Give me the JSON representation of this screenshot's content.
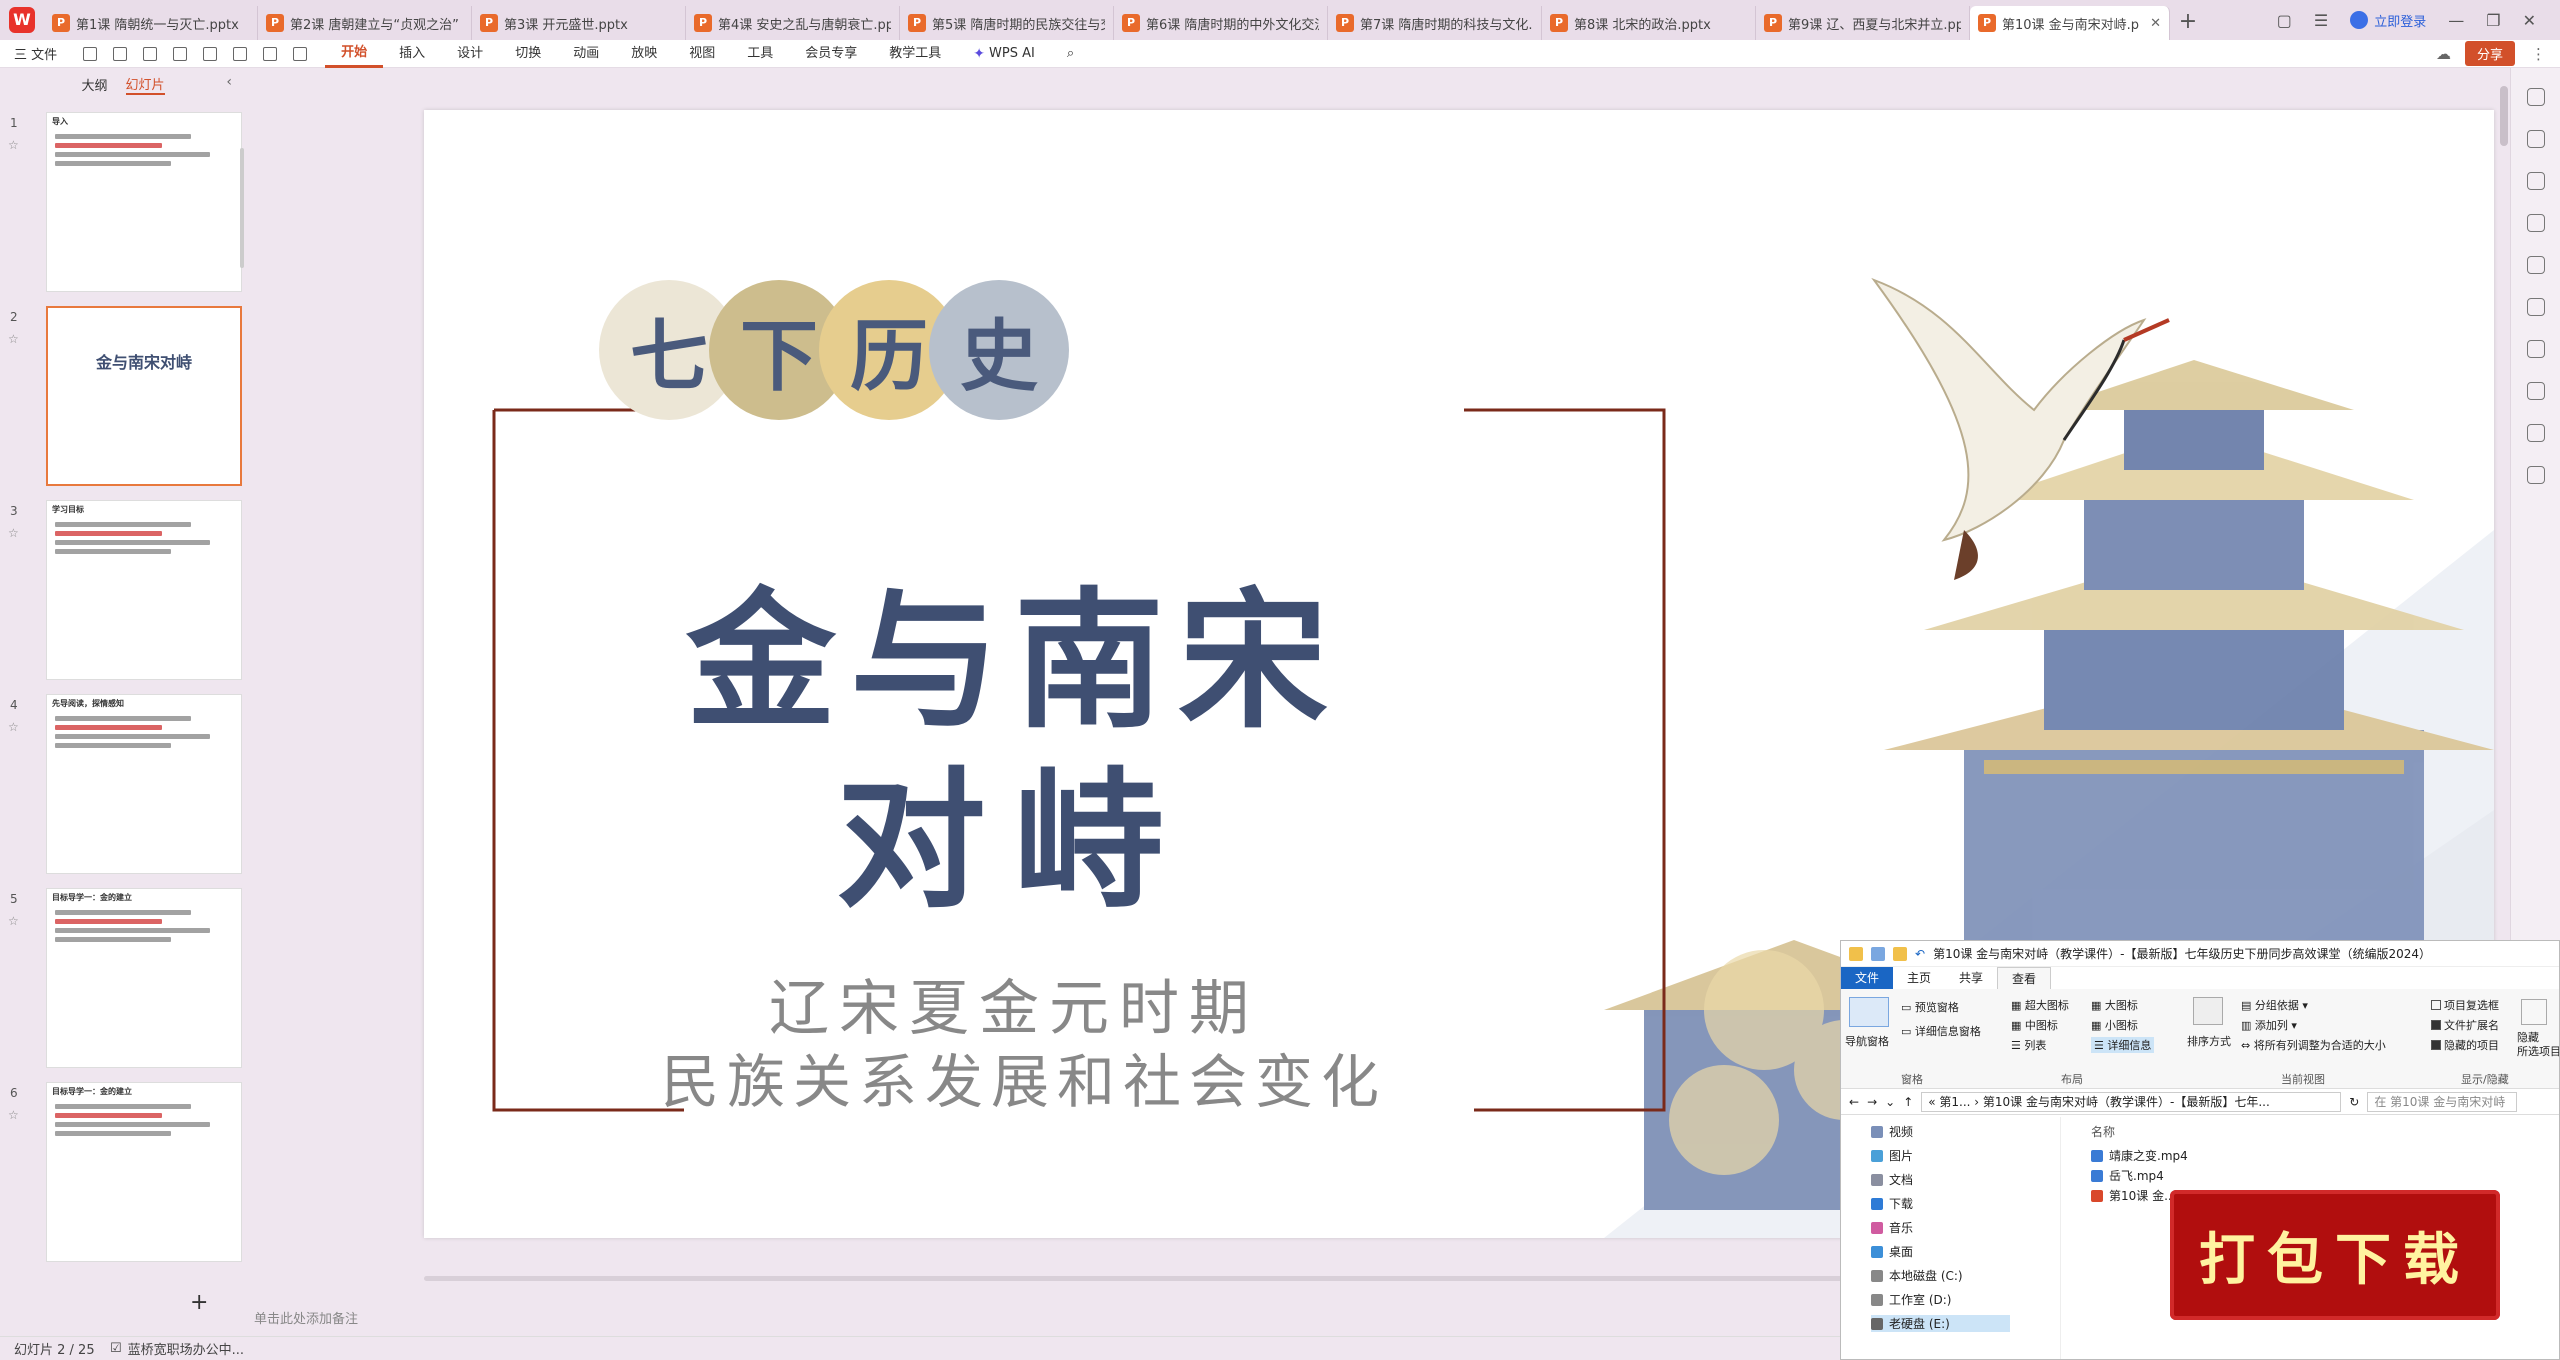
{
  "app": {
    "logo_letter": "W"
  },
  "tabs": [
    {
      "label": "第1课 隋朝统一与灭亡.pptx",
      "active": false
    },
    {
      "label": "第2课 唐朝建立与“贞观之治”",
      "active": false
    },
    {
      "label": "第3课 开元盛世.pptx",
      "active": false
    },
    {
      "label": "第4课 安史之乱与唐朝衰亡.pptx",
      "active": false
    },
    {
      "label": "第5课 隋唐时期的民族交往与交",
      "active": false
    },
    {
      "label": "第6课 隋唐时期的中外文化交流",
      "active": false
    },
    {
      "label": "第7课 隋唐时期的科技与文化.p",
      "active": false
    },
    {
      "label": "第8课 北宋的政治.pptx",
      "active": false
    },
    {
      "label": "第9课 辽、西夏与北宋并立.ppt",
      "active": false
    },
    {
      "label": "第10课 金与南宋对峙.p",
      "active": true
    }
  ],
  "tab_icon_letter": "P",
  "tabbar": {
    "add": "+",
    "login": "立即登录",
    "minimize": "—",
    "restore": "❐",
    "close": "✕"
  },
  "menu": {
    "file": "三 文件",
    "items": [
      "开始",
      "插入",
      "设计",
      "切换",
      "动画",
      "放映",
      "视图",
      "工具",
      "会员专享",
      "教学工具"
    ],
    "active_index": 0,
    "wps_ai": "WPS AI",
    "share": "分享"
  },
  "left_panel": {
    "tabs": [
      "大纲",
      "幻灯片"
    ],
    "active_tab": 1,
    "collapse": "‹",
    "add": "+",
    "thumbs": [
      {
        "num": "1",
        "title": "导入",
        "selected": false
      },
      {
        "num": "2",
        "title": "金与南宋对峙",
        "selected": true
      },
      {
        "num": "3",
        "title": "学习目标",
        "selected": false
      },
      {
        "num": "4",
        "title": "先导阅读，探情感知",
        "selected": false
      },
      {
        "num": "5",
        "title": "目标导学一：金的建立",
        "selected": false
      },
      {
        "num": "6",
        "title": "目标导学一：金的建立",
        "selected": false
      }
    ]
  },
  "slide": {
    "circles": [
      "七",
      "下",
      "历",
      "史"
    ],
    "circle_colors": [
      "#ece6d6",
      "#cdbd8d",
      "#e6cd8e",
      "#b7c0cc"
    ],
    "title_line1": "金与南宋",
    "title_line2": "对峙",
    "subtitle_line1": "辽宋夏金元时期",
    "subtitle_line2": "民族关系发展和社会变化",
    "accent_frame_color": "#7a2a1a"
  },
  "notes_placeholder": "单击此处添加备注",
  "status": {
    "slide_count": "幻灯片 2 / 25",
    "doc_status": "蓝桥宽职场办公中..."
  },
  "explorer": {
    "title": "第10课 金与南宋对峙（教学课件）-【最新版】七年级历史下册同步高效课堂（统编版2024）",
    "ribbon_tabs": [
      "文件",
      "主页",
      "共享",
      "查看"
    ],
    "active_ribbon_tab": 3,
    "pane_group": {
      "nav_pane": "导航窗格",
      "preview": "预览窗格",
      "details": "详细信息窗格",
      "label": "窗格"
    },
    "layout_group": {
      "xl": "超大图标",
      "l": "大图标",
      "m": "中图标",
      "s": "小图标",
      "list": "列表",
      "details": "详细信息",
      "label": "布局"
    },
    "view_group": {
      "sort": "排序方式",
      "group": "分组依据",
      "addcol": "添加列",
      "fit": "将所有列调整为合适的大小",
      "label": "当前视图"
    },
    "show_group": {
      "checkboxes": "项目复选框",
      "ext": "文件扩展名",
      "hidden": "隐藏的项目",
      "hide": "隐藏",
      "hide_sel": "所选项目",
      "label": "显示/隐藏"
    },
    "address": "« 第1... › 第10课 金与南宋对峙（教学课件）-【最新版】七年...",
    "search": "在 第10课 金与南宋对峙",
    "nav": [
      "视频",
      "图片",
      "文档",
      "下载",
      "音乐",
      "桌面",
      "本地磁盘 (C:)",
      "工作室 (D:)",
      "老硬盘 (E:)"
    ],
    "column_name": "名称",
    "files": [
      "靖康之变.mp4",
      "岳飞.mp4",
      "第10课 金..."
    ]
  },
  "download_stamp": "打包下载"
}
